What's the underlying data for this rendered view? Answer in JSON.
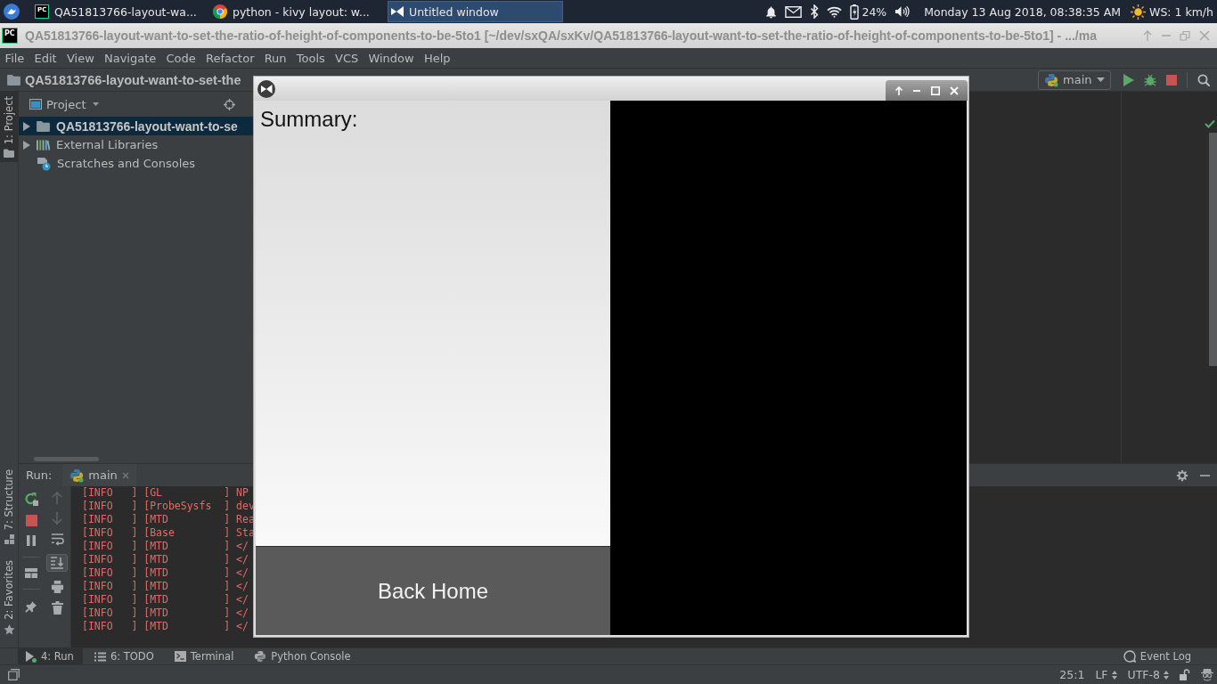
{
  "taskbar": {
    "tasks": [
      {
        "kind": "ide",
        "logo_text": "PC",
        "label": "QA51813766-layout-wa...",
        "selected": false
      },
      {
        "kind": "browser",
        "label": "python - kivy layout: w...",
        "selected": false
      },
      {
        "kind": "kivy",
        "label": "Untitled window",
        "selected": true
      }
    ],
    "battery": "24%",
    "clock": "Monday 13 Aug 2018, 08:38:35 AM",
    "weather": "WS: 1 km/h"
  },
  "ide": {
    "logo_text": "PC",
    "title": "QA51813766-layout-want-to-set-the-ratio-of-height-of-components-to-be-5to1 [~/dev/sxQA/sxKv/QA51813766-layout-want-to-set-the-ratio-of-height-of-components-to-be-5to1] - .../ma",
    "menu": [
      "File",
      "Edit",
      "View",
      "Navigate",
      "Code",
      "Refactor",
      "Run",
      "Tools",
      "VCS",
      "Window",
      "Help"
    ],
    "breadcrumb": "QA51813766-layout-want-to-set-the",
    "run_config": "main",
    "left_strip": {
      "top": [
        {
          "kind": "project",
          "label": "1: Project",
          "selected": true
        }
      ],
      "bottom": [
        {
          "kind": "structure",
          "label": "7: Structure",
          "selected": false
        },
        {
          "kind": "favorites",
          "label": "2: Favorites",
          "selected": false
        }
      ]
    },
    "project_panel": {
      "title": "Project",
      "items": [
        {
          "kind": "folder",
          "label": "QA51813766-layout-want-to-se",
          "selected": true,
          "expanded": false
        },
        {
          "kind": "library",
          "label": "External Libraries",
          "selected": false,
          "expanded": false
        },
        {
          "kind": "scratches",
          "label": "Scratches and Consoles",
          "selected": false
        }
      ]
    },
    "run_panel": {
      "title": "Run:",
      "tab": "main",
      "navigation_disabled": true,
      "scroll_to_end": true,
      "lines": [
        "[INFO   ] [GL          ] NP",
        "[INFO   ] [ProbeSysfs  ] dev",
        "[INFO   ] [MTD         ] Rea",
        "[INFO   ] [Base        ] Sta",
        "[INFO   ] [MTD         ] </",
        "[INFO   ] [MTD         ] </",
        "[INFO   ] [MTD         ] </",
        "[INFO   ] [MTD         ] </",
        "[INFO   ] [MTD         ] </",
        "[INFO   ] [MTD         ] </",
        "[INFO   ] [MTD         ] </"
      ]
    },
    "tool_tabs": [
      {
        "kind": "run",
        "label": "4: Run",
        "selected": true
      },
      {
        "kind": "todo",
        "label": "6: TODO",
        "selected": false
      },
      {
        "kind": "terminal",
        "label": "Terminal",
        "selected": false
      },
      {
        "kind": "python",
        "label": "Python Console",
        "selected": false
      }
    ],
    "event_log": "Event Log",
    "status_bar": {
      "position": "25:1",
      "line_separator": "LF",
      "encoding": "UTF-8"
    }
  },
  "kivy_window": {
    "label": "Summary:",
    "button": "Back Home"
  }
}
